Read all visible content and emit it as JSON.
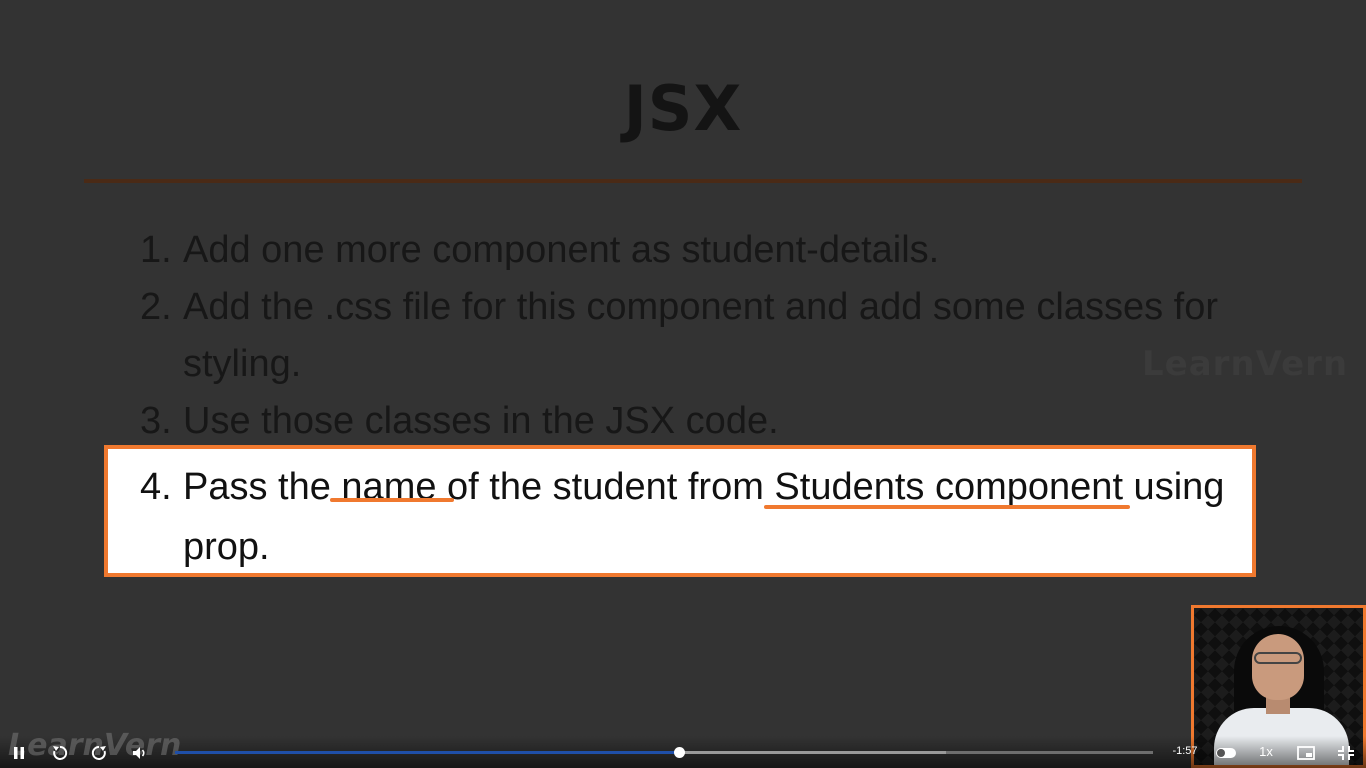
{
  "slide": {
    "title": "JSX",
    "items": [
      {
        "num": "1.",
        "text": "Add one more component as student-details."
      },
      {
        "num": "2.",
        "text": "Add the .css file for this component and add some classes for styling."
      },
      {
        "num": "3.",
        "text": "Use those classes in the JSX code."
      }
    ],
    "highlighted_item": {
      "num": "4.",
      "text": "Pass the name of the student from Students component using prop.",
      "underlined_words": [
        "name",
        "Students component"
      ]
    },
    "watermark_right": "LearnVern"
  },
  "player": {
    "watermark_left": "LearnVern",
    "time_remaining": "-1:57",
    "speed": "1x",
    "progress_played": 0.515,
    "progress_buffered": 0.788,
    "icons": {
      "pause": "pause-icon",
      "rewind": "rewind-icon",
      "forward": "forward-icon",
      "volume": "volume-icon",
      "toggle": "toggle-icon",
      "pip": "picture-in-picture-icon",
      "exit_fullscreen": "exit-fullscreen-icon"
    }
  },
  "colors": {
    "accent": "#f0792f",
    "progress": "#1f4fa8"
  }
}
